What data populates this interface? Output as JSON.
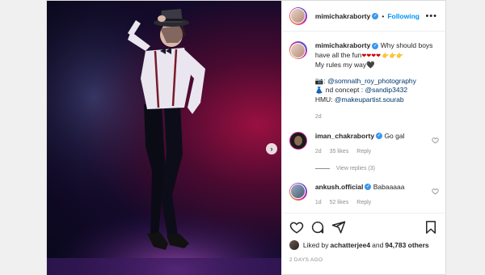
{
  "header": {
    "username": "mimichakraborty",
    "dot": "•",
    "follow_label": "Following",
    "more_icon": "more-horizontal-icon"
  },
  "caption": {
    "username": "mimichakraborty",
    "text_line1": "Why should boys",
    "text_line2": "have all the fun",
    "emojis_line2": "❤❤❤❤ 👉👉👉",
    "text_line3": "My rules my way",
    "emoji_line3": "🖤",
    "credit1_emoji": "📷",
    "credit1": ": @somnath_roy_photography",
    "credit2_emoji": "👗",
    "credit2_prefix": "nd concept : ",
    "credit2_tag": "@sandip3432",
    "credit3_prefix": "HMU: ",
    "credit3_tag": "@makeupartist.sourab",
    "age": "2d"
  },
  "comments": [
    {
      "username": "iman_chakraborty",
      "text": "Go gal",
      "age": "2d",
      "likes": "35 likes",
      "reply": "Reply",
      "view_replies": "View replies (3)"
    },
    {
      "username": "ankush.official",
      "text": "Babaaaaa",
      "age": "1d",
      "likes": "52 likes",
      "reply": "Reply"
    }
  ],
  "likes": {
    "prefix": "Liked by ",
    "user": "achatterjee4",
    "middle": " and ",
    "others": "94,783 others"
  },
  "timestamp": "2 DAYS AGO",
  "colors": {
    "link": "#00376b",
    "follow": "#0095f6",
    "verified": "#3897f0",
    "muted": "#8e8e8e"
  }
}
